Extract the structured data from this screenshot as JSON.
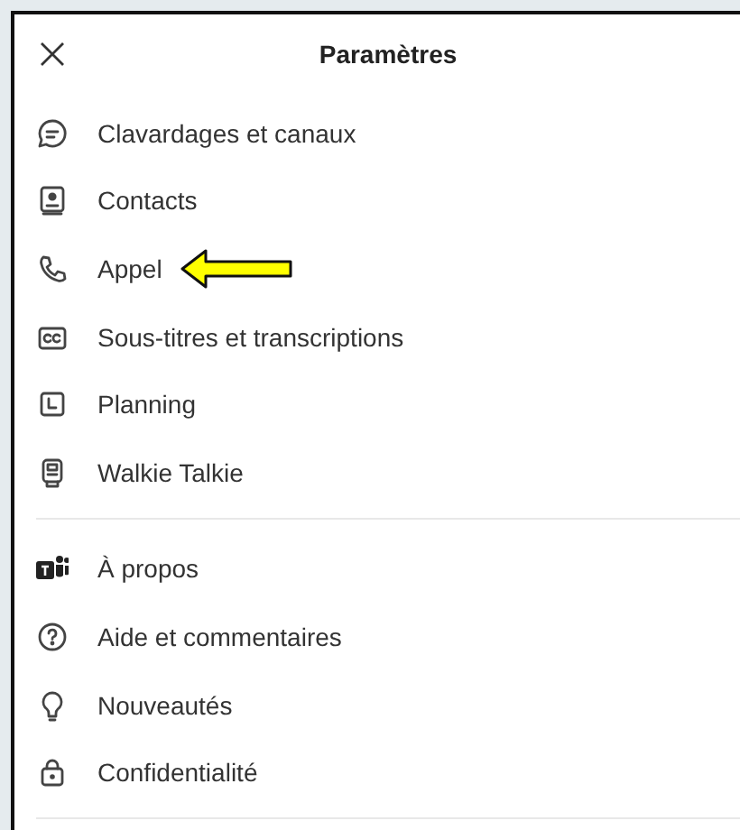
{
  "header": {
    "title": "Paramètres"
  },
  "sections": [
    {
      "items": [
        {
          "kind": "chat",
          "label": "Clavardages et canaux",
          "annotated": false
        },
        {
          "kind": "contact",
          "label": "Contacts",
          "annotated": false
        },
        {
          "kind": "phone",
          "label": "Appel",
          "annotated": true
        },
        {
          "kind": "captions",
          "label": "Sous-titres et transcriptions",
          "annotated": false
        },
        {
          "kind": "calendar",
          "label": "Planning",
          "annotated": false
        },
        {
          "kind": "walkie",
          "label": "Walkie Talkie",
          "annotated": false
        }
      ]
    },
    {
      "items": [
        {
          "kind": "app",
          "label": "À propos",
          "annotated": false
        },
        {
          "kind": "help",
          "label": "Aide et commentaires",
          "annotated": false
        },
        {
          "kind": "bulb",
          "label": "Nouveautés",
          "annotated": false
        },
        {
          "kind": "lock",
          "label": "Confidentialité",
          "annotated": false
        }
      ]
    }
  ]
}
